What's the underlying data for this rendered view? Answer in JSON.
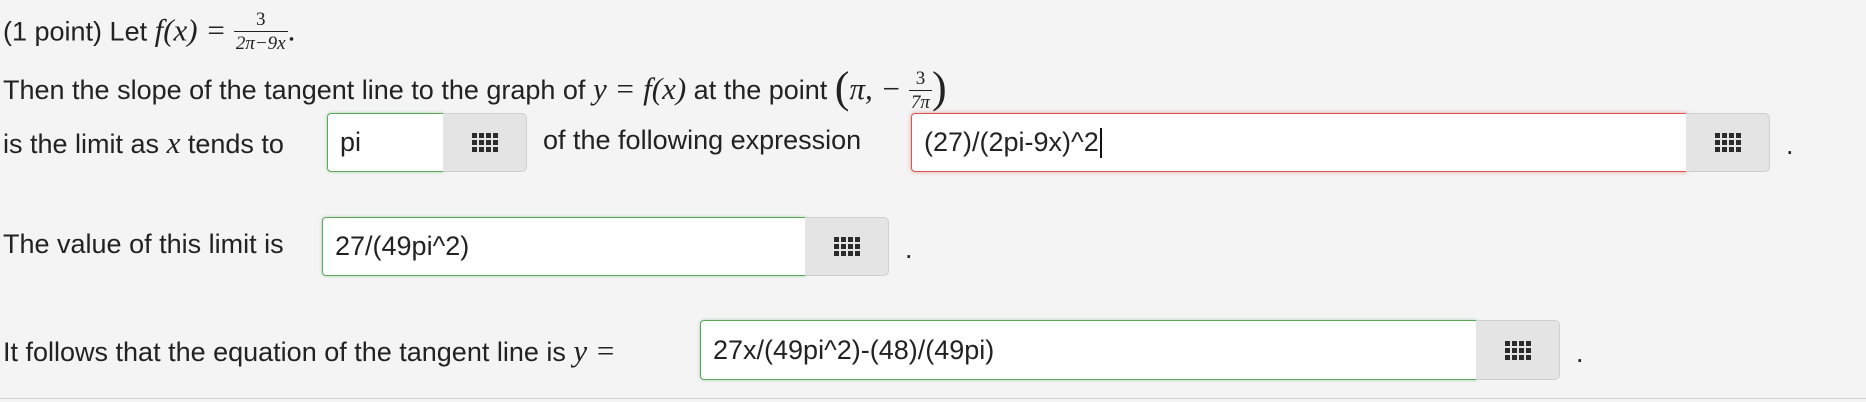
{
  "problem": {
    "points_label": "(1 point) Let",
    "function_lhs": "f(x) =",
    "function_frac": {
      "num": "3",
      "den": "2π−9x"
    },
    "function_end": ".",
    "line2_text": "Then the slope of the tangent line to the graph of",
    "line2_eq": "y = f(x)",
    "line2_point_text": "at the point",
    "point_x": "π, −",
    "point_frac": {
      "num": "3",
      "den": "7π"
    },
    "line3_text_a": "is the limit as",
    "line3_var": "x",
    "line3_text_b": "tends to",
    "line3_text_c": "of the following expression",
    "line4_text": "The value of this limit is",
    "line5_text": "It follows that the equation of the tangent line is",
    "line5_var": "y =",
    "period": "."
  },
  "answers": {
    "limit_point": {
      "value": "pi",
      "status": "correct"
    },
    "expression": {
      "value": "(27)/(2pi-9x)^2",
      "status": "incorrect"
    },
    "limit_value": {
      "value": "27/(49pi^2)",
      "status": "correct"
    },
    "tangent_eq": {
      "value": "27x/(49pi^2)-(48)/(49pi)",
      "status": "correct"
    }
  },
  "icons": {
    "keyboard": "keyboard-icon"
  },
  "colors": {
    "correct": "#59a85a",
    "incorrect": "#d9534f",
    "background": "#f4f4f4"
  }
}
